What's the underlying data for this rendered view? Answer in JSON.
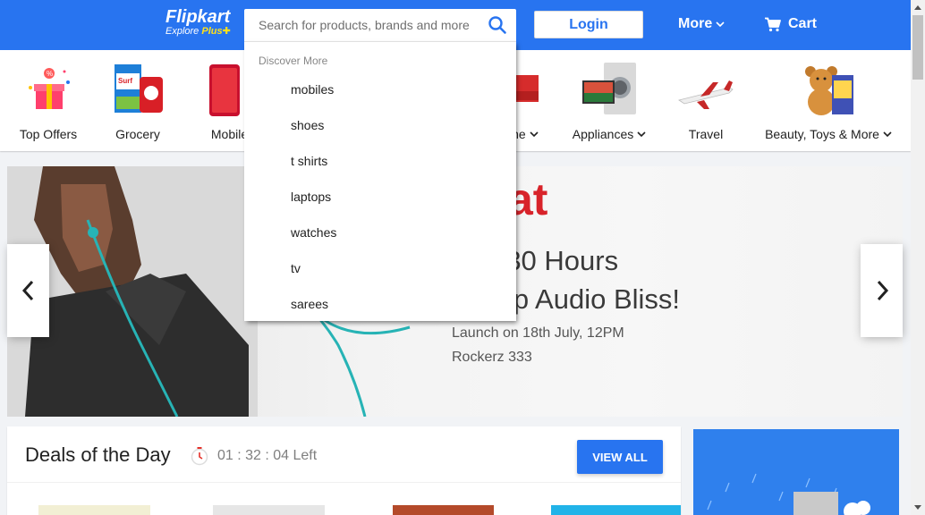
{
  "header": {
    "logo_text": "Flipkart",
    "logo_sub": "Explore",
    "logo_plus": "Plus",
    "search_placeholder": "Search for products, brands and more",
    "login_label": "Login",
    "more_label": "More",
    "cart_label": "Cart",
    "brand_color": "#2874f0"
  },
  "categories": [
    {
      "label": "Top Offers",
      "icon": "gift-icon"
    },
    {
      "label": "Grocery",
      "icon": "grocery-icon"
    },
    {
      "label": "Mobiles",
      "icon": "mobile-phone-icon"
    },
    {
      "label": "Home",
      "icon": "sofa-icon"
    },
    {
      "label": "Appliances",
      "icon": "washing-machine-icon"
    },
    {
      "label": "Travel",
      "icon": "airplane-icon"
    },
    {
      "label": "Beauty, Toys & More",
      "icon": "teddy-bear-icon"
    }
  ],
  "search_dropdown": {
    "heading": "Discover More",
    "items": [
      "mobiles",
      "shoes",
      "t shirts",
      "laptops",
      "watches",
      "tv",
      "sarees"
    ]
  },
  "banner": {
    "brand": "at",
    "line1": "p to 30 Hours",
    "line2": "n-stop Audio Bliss!",
    "line3": "Launch on 18th July, 12PM",
    "line4": "Rockerz 333"
  },
  "deals": {
    "title": "Deals of the Day",
    "timer": "01 : 32 : 04 Left",
    "view_all": "VIEW ALL"
  }
}
